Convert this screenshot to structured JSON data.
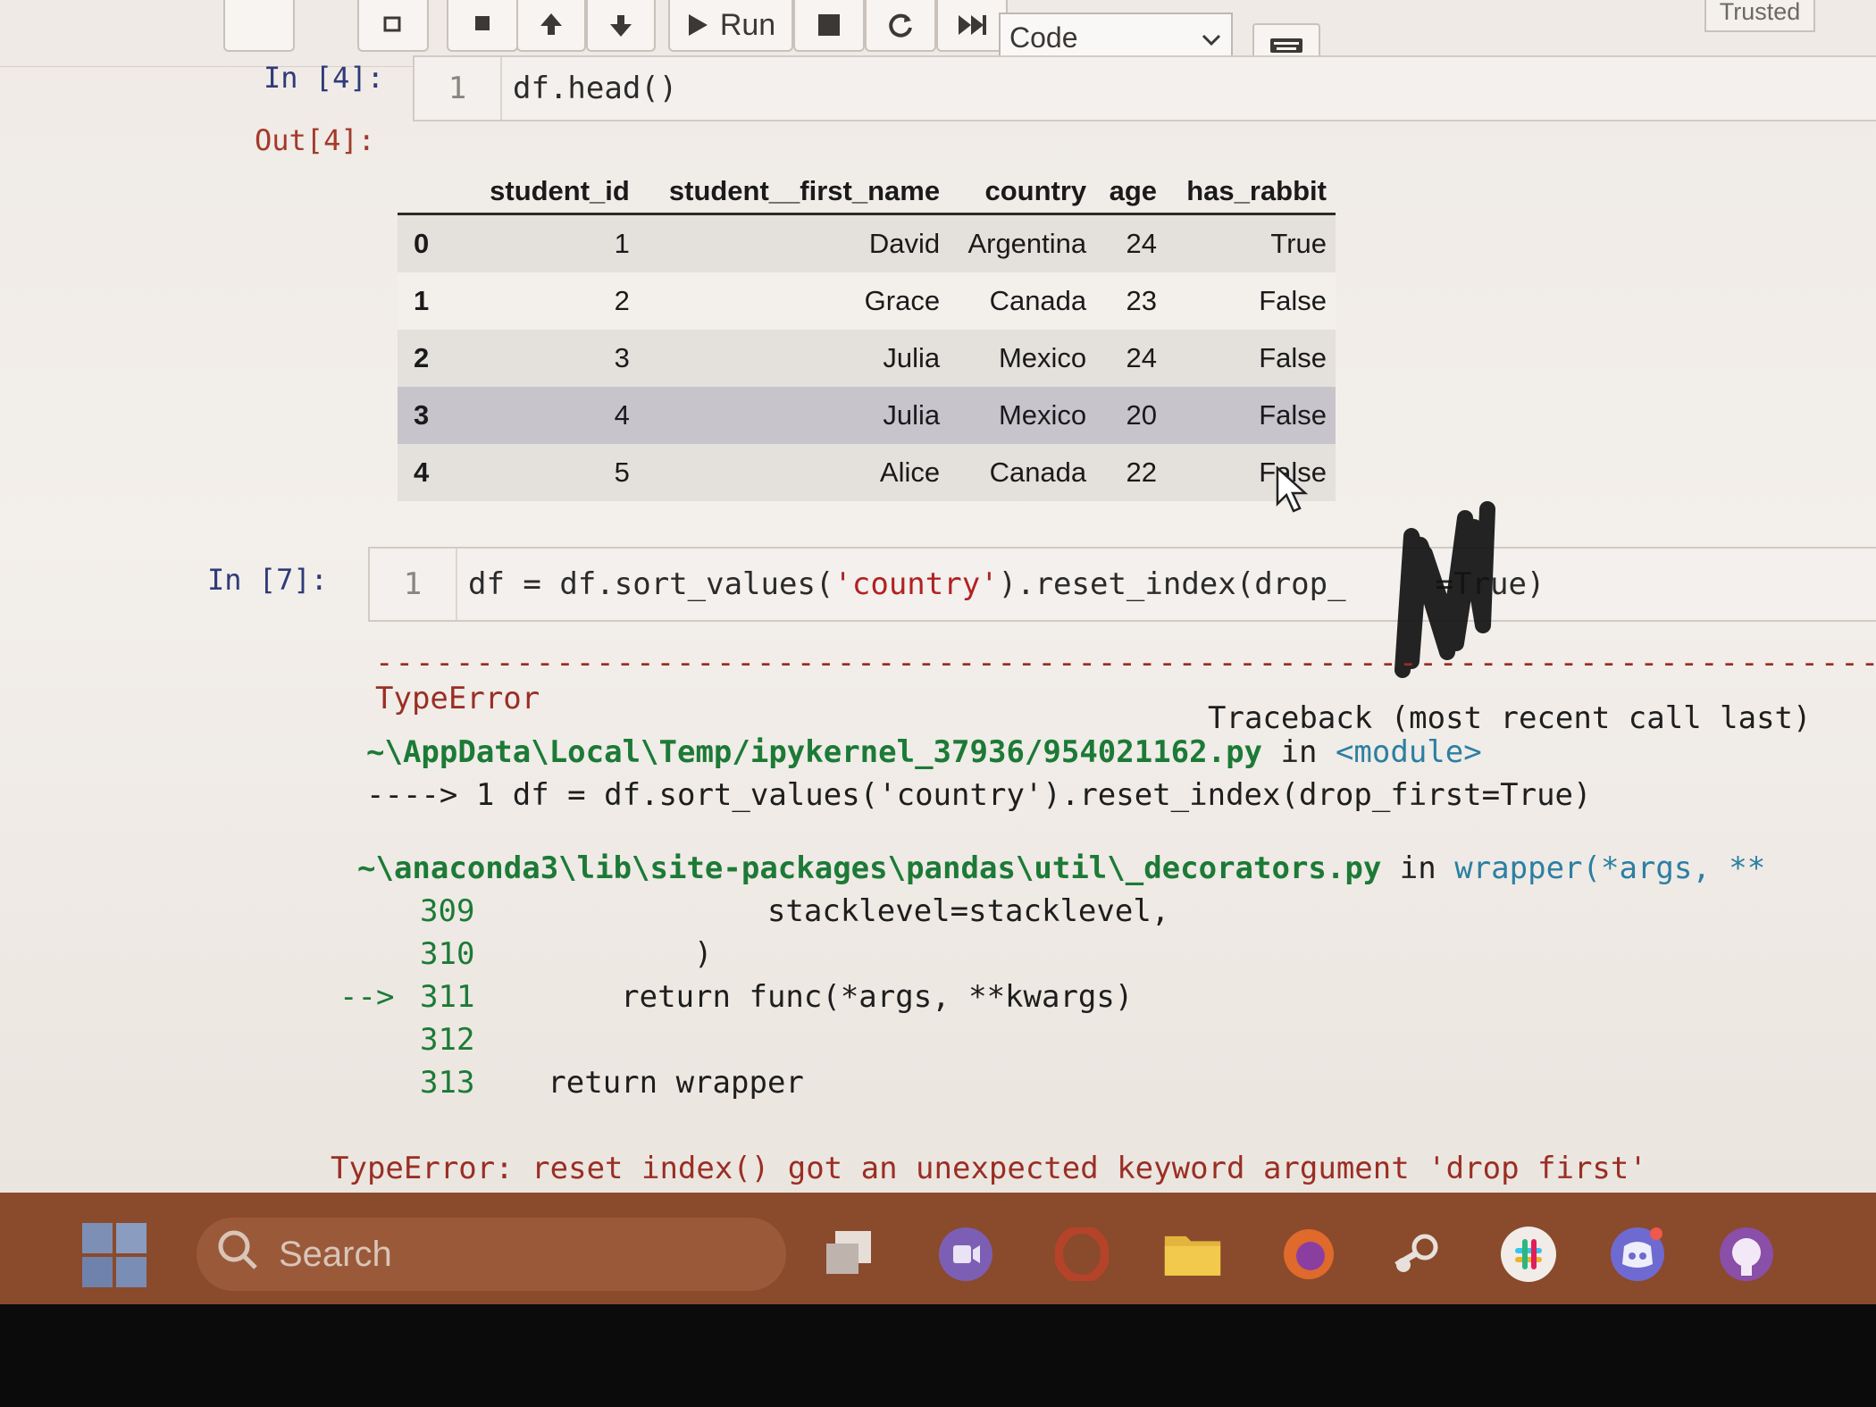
{
  "toolbar": {
    "run_label": "Run",
    "cell_type": "Code",
    "trusted_label": "Trusted"
  },
  "cells": [
    {
      "in_prompt": "In [4]:",
      "line_number": "1",
      "code": "df.head()",
      "out_prompt": "Out[4]:"
    },
    {
      "in_prompt": "In [7]:",
      "line_number": "1",
      "code_before": "df = df.sort_values(",
      "code_string": "'country'",
      "code_after_visible": ").reset_index(drop_",
      "code_tail_visible": "=True)"
    }
  ],
  "dataframe": {
    "columns": [
      "",
      "student_id",
      "student__first_name",
      "country",
      "age",
      "has_rabbit"
    ],
    "rows": [
      [
        "0",
        "1",
        "David",
        "Argentina",
        "24",
        "True"
      ],
      [
        "1",
        "2",
        "Grace",
        "Canada",
        "23",
        "False"
      ],
      [
        "2",
        "3",
        "Julia",
        "Mexico",
        "24",
        "False"
      ],
      [
        "3",
        "4",
        "Julia",
        "Mexico",
        "20",
        "False"
      ],
      [
        "4",
        "5",
        "Alice",
        "Canada",
        "22",
        "False"
      ]
    ]
  },
  "traceback": {
    "error_type": "TypeError",
    "header": "Traceback (most recent call last)",
    "file1": "~\\AppData\\Local\\Temp/ipykernel_37936/954021162.py",
    "in_word": "in",
    "module": "<module>",
    "arrow_line": "----> 1 df = df.sort_values('country').reset_index(drop_first=True)",
    "file2": "~\\anaconda3\\lib\\site-packages\\pandas\\util\\_decorators.py",
    "wrapper": "wrapper(*args, **",
    "frame_lines": [
      {
        "marker": "",
        "num": "309",
        "code": "                stacklevel=stacklevel,"
      },
      {
        "marker": "",
        "num": "310",
        "code": "            )"
      },
      {
        "marker": "-->",
        "num": "311",
        "code": "        return func(*args, **kwargs)"
      },
      {
        "marker": "",
        "num": "312",
        "code": ""
      },
      {
        "marker": "",
        "num": "313",
        "code": "    return wrapper"
      }
    ],
    "final_error": "TypeError: reset index() got an unexpected keyword argument 'drop first'"
  },
  "taskbar": {
    "search_placeholder": "Search",
    "icons": [
      "windows-start-icon",
      "task-view-icon",
      "teams-icon",
      "opera-icon",
      "file-explorer-icon",
      "firefox-icon",
      "steam-icon",
      "slack-icon",
      "discord-icon",
      "github-icon"
    ]
  },
  "colors": {
    "in_prompt": "#2f3b78",
    "out_prompt": "#a33a2a",
    "taskbar": "#8a4a2c",
    "row_hover": "#c7c4cc"
  }
}
